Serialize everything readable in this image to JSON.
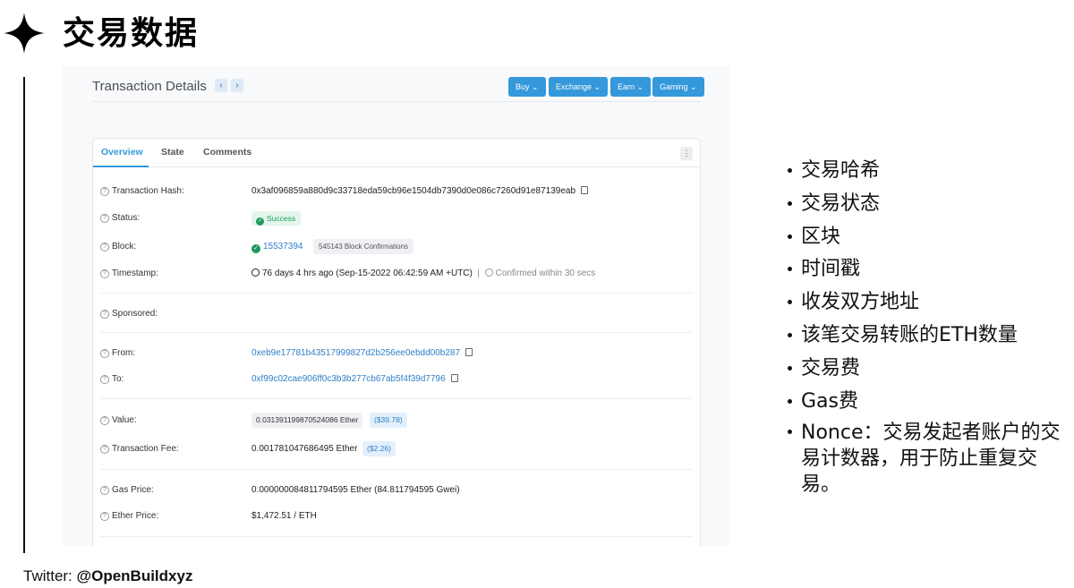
{
  "slide": {
    "title": "交易数据",
    "footer_prefix": "Twitter: ",
    "footer_handle": "@OpenBuildxyz"
  },
  "header": {
    "title": "Transaction Details",
    "prev_icon": "‹",
    "next_icon": "›",
    "menus": [
      "Buy",
      "Exchange",
      "Earn",
      "Gaming"
    ]
  },
  "tabs": [
    "Overview",
    "State",
    "Comments"
  ],
  "more_icon": "⋮",
  "fields": {
    "hash_label": "Transaction Hash:",
    "hash_value": "0x3af096859a880d9c33718eda59cb96e1504db7390d0e086c7260d91e87139eab",
    "status_label": "Status:",
    "status_value": "Success",
    "block_label": "Block:",
    "block_value": "15537394",
    "block_confirmations": "545143 Block Confirmations",
    "timestamp_label": "Timestamp:",
    "timestamp_value": "76 days 4 hrs ago (Sep-15-2022 06:42:59 AM +UTC)",
    "timestamp_sep": "|",
    "timestamp_confirmed": "Confirmed within 30 secs",
    "sponsored_label": "Sponsored:",
    "from_label": "From:",
    "from_value": "0xeb9e17781b43517999827d2b256ee0ebdd00b287",
    "to_label": "To:",
    "to_value": "0xf99c02cae906ff0c3b3b277cb67ab5f4f39d7796",
    "value_label": "Value:",
    "value_value": "0.031391199870524086 Ether",
    "value_usd": "($39.78)",
    "fee_label": "Transaction Fee:",
    "fee_value": "0.001781047686495 Ether",
    "fee_usd": "($2.26)",
    "gas_price_label": "Gas Price:",
    "gas_price_value": "0.000000084811794595 Ether (84.811794595 Gwei)",
    "ether_price_label": "Ether Price:",
    "ether_price_value": "$1,472.51 / ETH"
  },
  "bullets": [
    "交易哈希",
    "交易状态",
    "区块",
    "时间戳",
    "收发双方地址",
    "该笔交易转账的ETH数量",
    "交易费",
    "Gas费",
    "Nonce：交易发起者账户的交易计数器，用于防止重复交易。"
  ],
  "colors": {
    "accent": "#3498db",
    "link": "#2f7fc6",
    "success": "#1d9a5b"
  }
}
